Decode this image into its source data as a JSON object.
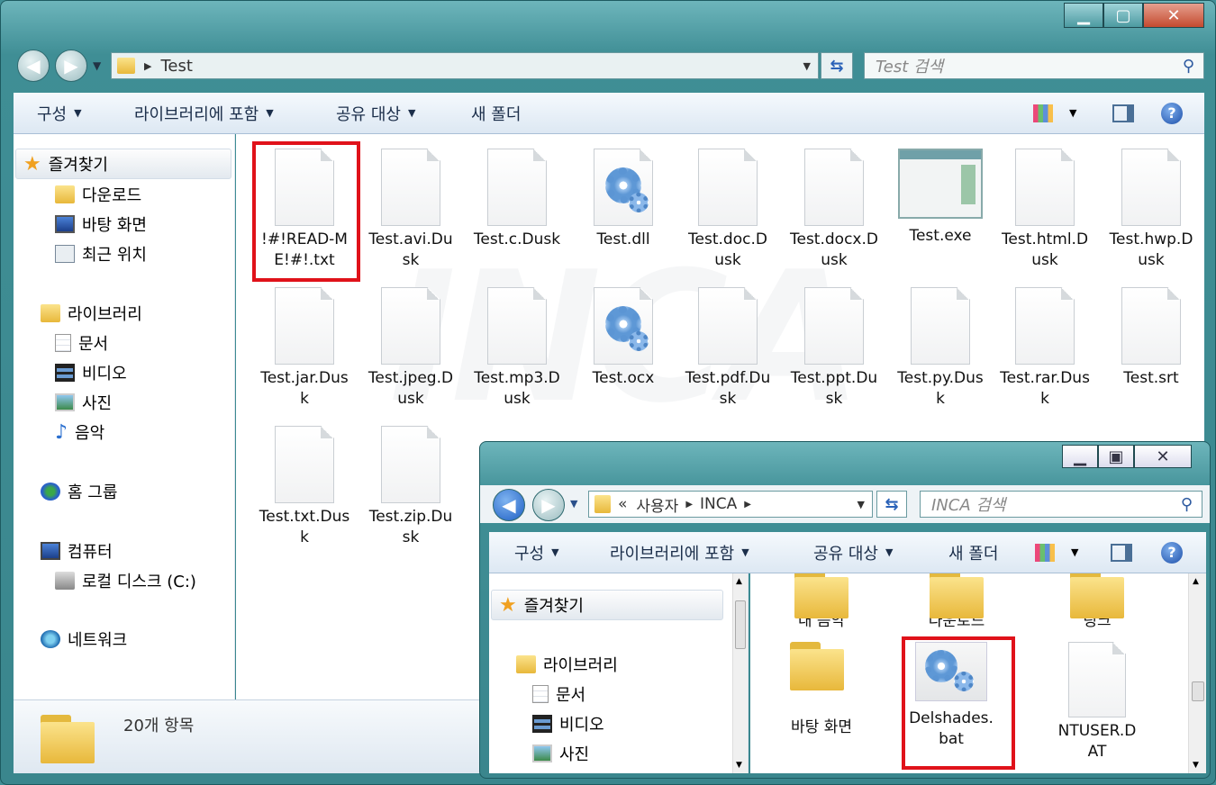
{
  "main": {
    "address": {
      "path": "Test"
    },
    "search": {
      "placeholder": "Test 검색"
    },
    "toolbar": {
      "organize": "구성",
      "include_library": "라이브러리에 포함",
      "share": "공유 대상",
      "new_folder": "새 폴더"
    },
    "nav": {
      "favorites": "즐겨찾기",
      "downloads": "다운로드",
      "desktop": "바탕 화면",
      "recent": "최근 위치",
      "libraries": "라이브러리",
      "documents": "문서",
      "videos": "비디오",
      "pictures": "사진",
      "music": "음악",
      "homegroup": "홈 그룹",
      "computer": "컴퓨터",
      "local_disk": "로컬 디스크 (C:)",
      "network": "네트워크"
    },
    "files": [
      [
        "!#!READ-M",
        "E!#!.txt"
      ],
      [
        "Test.avi.Du",
        "sk"
      ],
      [
        "Test.c.Dusk"
      ],
      [
        "Test.dll"
      ],
      [
        "Test.doc.D",
        "usk"
      ],
      [
        "Test.docx.D",
        "usk"
      ],
      [
        "Test.exe"
      ],
      [
        "Test.html.D",
        "usk"
      ],
      [
        "Test.hwp.D",
        "usk"
      ],
      [
        "Test.jar.Dus",
        "k"
      ],
      [
        "Test.jpeg.D",
        "usk"
      ],
      [
        "Test.mp3.D",
        "usk"
      ],
      [
        "Test.ocx"
      ],
      [
        "Test.pdf.Du",
        "sk"
      ],
      [
        "Test.ppt.Du",
        "sk"
      ],
      [
        "Test.py.Dus",
        "k"
      ],
      [
        "Test.rar.Dus",
        "k"
      ],
      [
        "Test.srt"
      ],
      [
        "Test.txt.Dus",
        "k"
      ],
      [
        "Test.zip.Du",
        "sk"
      ]
    ],
    "status": {
      "count": "20개 항목"
    }
  },
  "second": {
    "address": {
      "prefix": "«",
      "seg1": "사용자",
      "seg2": "INCA"
    },
    "search": {
      "placeholder": "INCA 검색"
    },
    "toolbar": {
      "organize": "구성",
      "include_library": "라이브러리에 포함",
      "share": "공유 대상",
      "new_folder": "새 폴더"
    },
    "nav": {
      "favorites": "즐겨찾기",
      "libraries": "라이브러리",
      "documents": "문서",
      "videos": "비디오",
      "pictures": "사진"
    },
    "items": {
      "my_music": "내 음악",
      "downloads": "다운로드",
      "links": "링크",
      "desktop": "바탕 화면",
      "bat": [
        "Delshades.",
        "bat"
      ],
      "ntuser": [
        "NTUSER.D",
        "AT"
      ]
    }
  },
  "watermark": "INCA"
}
